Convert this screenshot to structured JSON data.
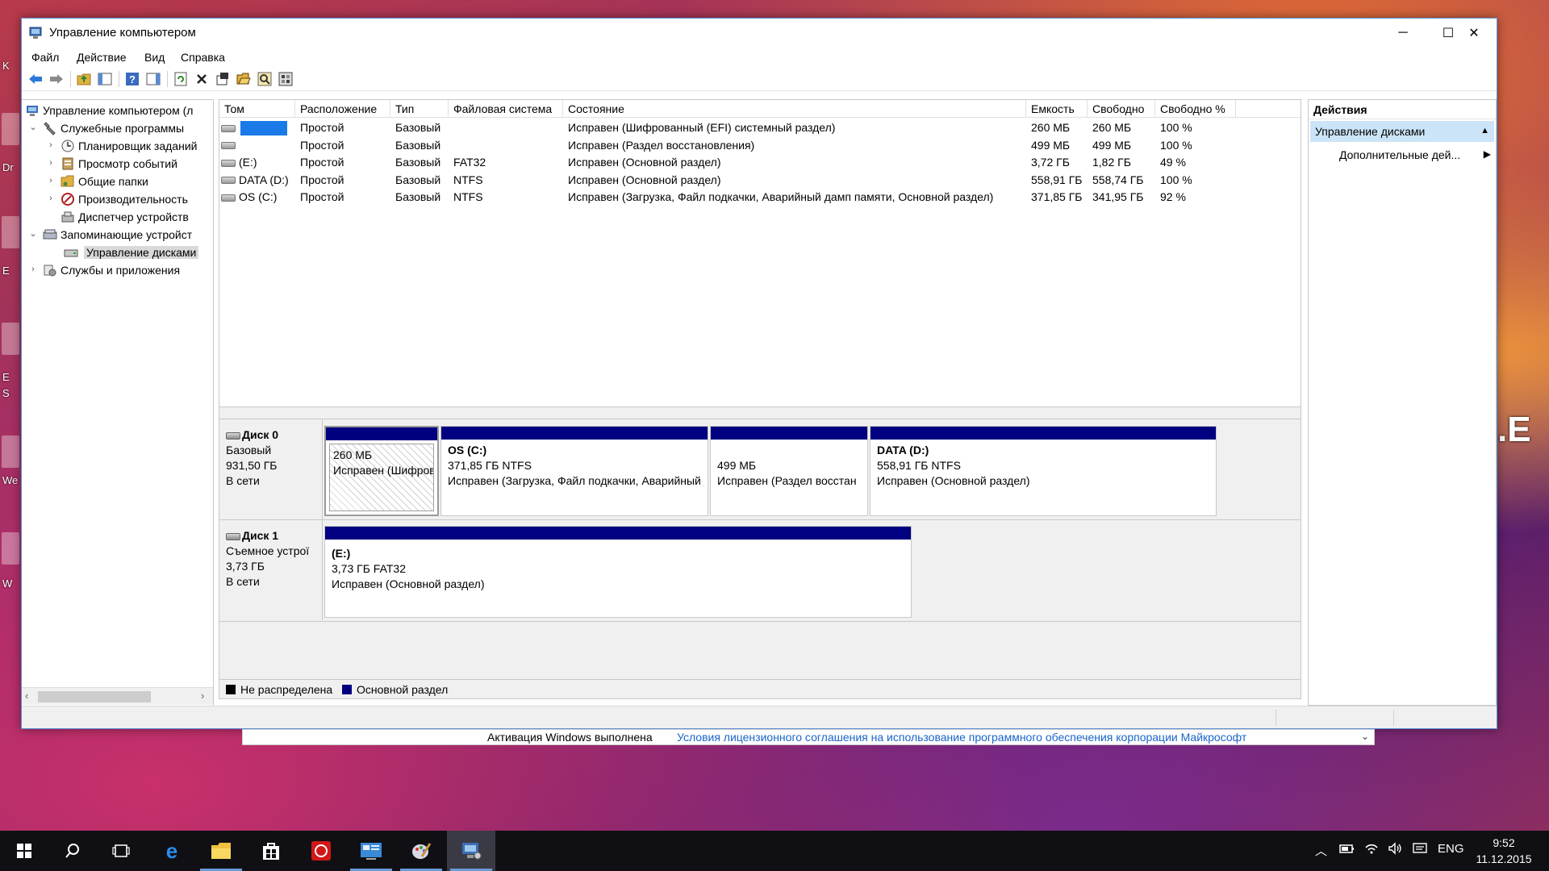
{
  "desktop": {
    "side_labels": [
      "K",
      "Dr",
      "E",
      "E",
      "S",
      "We",
      "W"
    ],
    "right_fragment": ".E"
  },
  "window": {
    "title": "Управление компьютером",
    "controls": {
      "minimize": "─",
      "maximize": "☐",
      "close": "✕"
    }
  },
  "menu": [
    "Файл",
    "Действие",
    "Вид",
    "Справка"
  ],
  "toolbar_icons": [
    "back-icon",
    "forward-icon",
    "up-folder-icon",
    "show-hide-tree-icon",
    "help-icon",
    "show-action-pane-icon",
    "refresh-icon",
    "delete-icon",
    "properties-icon",
    "open-icon",
    "search-icon",
    "settings-icon"
  ],
  "tree": {
    "root": "Управление компьютером (л",
    "items": [
      {
        "label": "Служебные программы",
        "level": 1,
        "expanded": true,
        "icon": "tools-icon"
      },
      {
        "label": "Планировщик заданий",
        "level": 2,
        "expanded": false,
        "icon": "clock-icon"
      },
      {
        "label": "Просмотр событий",
        "level": 2,
        "expanded": false,
        "icon": "event-viewer-icon"
      },
      {
        "label": "Общие папки",
        "level": 2,
        "expanded": false,
        "icon": "shared-folder-icon"
      },
      {
        "label": "Производительность",
        "level": 2,
        "expanded": false,
        "icon": "performance-icon"
      },
      {
        "label": "Диспетчер устройств",
        "level": 2,
        "expanded": null,
        "icon": "device-manager-icon"
      },
      {
        "label": "Запоминающие устройст",
        "level": 1,
        "expanded": true,
        "icon": "storage-icon"
      },
      {
        "label": "Управление дисками",
        "level": 2,
        "expanded": null,
        "icon": "disk-management-icon",
        "selected": true
      },
      {
        "label": "Службы и приложения",
        "level": 1,
        "expanded": false,
        "icon": "services-icon"
      }
    ]
  },
  "volumes": {
    "columns": [
      "Том",
      "Расположение",
      "Тип",
      "Файловая система",
      "Состояние",
      "Емкость",
      "Свободно",
      "Свободно %"
    ],
    "rows": [
      {
        "vol": "",
        "selected": true,
        "layout": "Простой",
        "type": "Базовый",
        "fs": "",
        "status": "Исправен (Шифрованный (EFI) системный раздел)",
        "capacity": "260 МБ",
        "free": "260 МБ",
        "pct": "100 %"
      },
      {
        "vol": "",
        "selected": false,
        "layout": "Простой",
        "type": "Базовый",
        "fs": "",
        "status": "Исправен (Раздел восстановления)",
        "capacity": "499 МБ",
        "free": "499 МБ",
        "pct": "100 %"
      },
      {
        "vol": "(E:)",
        "selected": false,
        "layout": "Простой",
        "type": "Базовый",
        "fs": "FAT32",
        "status": "Исправен (Основной раздел)",
        "capacity": "3,72 ГБ",
        "free": "1,82 ГБ",
        "pct": "49 %"
      },
      {
        "vol": "DATA (D:)",
        "selected": false,
        "layout": "Простой",
        "type": "Базовый",
        "fs": "NTFS",
        "status": "Исправен (Основной раздел)",
        "capacity": "558,91 ГБ",
        "free": "558,74 ГБ",
        "pct": "100 %"
      },
      {
        "vol": "OS (C:)",
        "selected": false,
        "layout": "Простой",
        "type": "Базовый",
        "fs": "NTFS",
        "status": "Исправен (Загрузка, Файл подкачки, Аварийный дамп памяти, Основной раздел)",
        "capacity": "371,85 ГБ",
        "free": "341,95 ГБ",
        "pct": "92 %"
      }
    ]
  },
  "disks": [
    {
      "name": "Диск 0",
      "type": "Базовый",
      "size": "931,50 ГБ",
      "state": "В сети",
      "partitions": [
        {
          "name": "",
          "size": "260 МБ",
          "status": "Исправен (Шифрованн",
          "hatched": true
        },
        {
          "name": "OS  (C:)",
          "size": "371,85 ГБ NTFS",
          "status": "Исправен (Загрузка, Файл подкачки, Аварийный дамп п",
          "hatched": false
        },
        {
          "name": "",
          "size": "499 МБ",
          "status": "Исправен (Раздел восстан",
          "hatched": false
        },
        {
          "name": "DATA  (D:)",
          "size": "558,91 ГБ NTFS",
          "status": "Исправен (Основной раздел)",
          "hatched": false
        }
      ]
    },
    {
      "name": "Диск 1",
      "type": "Съемное устрої",
      "size": "3,73 ГБ",
      "state": "В сети",
      "partitions": [
        {
          "name": "(E:)",
          "size": "3,73 ГБ FAT32",
          "status": "Исправен (Основной раздел)",
          "hatched": false
        }
      ]
    }
  ],
  "legend": [
    {
      "label": "Не распределена",
      "color": "#000000"
    },
    {
      "label": "Основной раздел",
      "color": "#000080"
    }
  ],
  "actions": {
    "header": "Действия",
    "section": "Управление дисками",
    "item": "Дополнительные дей..."
  },
  "activation": {
    "text": "Активация Windows выполнена",
    "link": "Условия лицензионного соглашения на использование программного обеспечения корпорации Майкрософт"
  },
  "taskbar": {
    "apps": [
      "start-icon",
      "search-icon",
      "task-view-icon",
      "edge-icon",
      "file-explorer-icon",
      "store-icon",
      "opera-icon",
      "control-panel-icon",
      "paint-icon",
      "computer-management-icon"
    ],
    "tray_icons": [
      "chevron-up-icon",
      "battery-icon",
      "wifi-icon",
      "volume-icon",
      "notification-icon"
    ],
    "language": "ENG",
    "time": "9:52",
    "date": "11.12.2015"
  },
  "colors": {
    "primary_partition": "#000080",
    "selection": "#1a7ae8",
    "accent_blue": "#cce4f7",
    "link": "#1a64c8"
  }
}
